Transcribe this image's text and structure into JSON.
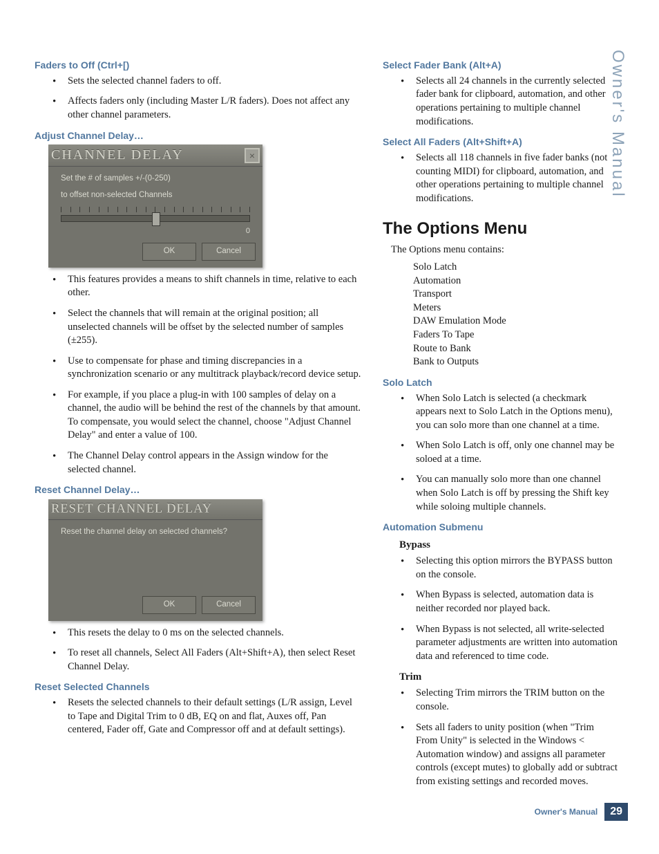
{
  "sideTab": "Owner's Manual",
  "footer": {
    "label": "Owner's Manual",
    "page": "29"
  },
  "left": {
    "sec1": {
      "title": "Faders to Off (Ctrl+[)",
      "b1": "Sets the selected channel faders to off.",
      "b2": "Affects faders only (including Master L/R faders). Does not affect any other channel parameters."
    },
    "sec2": {
      "title": "Adjust Channel Delay…",
      "dlgTitle": "CHANNEL DELAY",
      "dlgLine1": "Set the # of samples +/-(0-250)",
      "dlgLine2": "to offset non-selected Channels",
      "value": "0",
      "ok": "OK",
      "cancel": "Cancel",
      "b1": "This features provides a means to shift channels in time, relative to each other.",
      "b2": "Select the channels that will remain at the original position; all unselected channels will be offset by the selected number of samples (±255).",
      "b3": "Use to compensate for phase and timing discrepancies in a synchronization scenario or any multitrack playback/record device setup.",
      "b4": "For example, if you place a plug-in with 100 samples of delay on a channel, the audio will be behind the rest of the channels by that amount. To compensate, you would select the channel, choose \"Adjust Channel Delay\" and enter a value of 100.",
      "b5": "The Channel Delay control appears in the Assign window for the selected channel."
    },
    "sec3": {
      "title": "Reset Channel Delay…",
      "dlgTitle": "RESET CHANNEL DELAY",
      "dlgLine": "Reset the channel delay on selected channels?",
      "ok": "OK",
      "cancel": "Cancel",
      "b1": "This resets the delay to 0 ms on the selected channels.",
      "b2": "To reset all channels, Select All Faders (Alt+Shift+A), then select Reset Channel Delay."
    },
    "sec4": {
      "title": "Reset Selected Channels",
      "b1": "Resets the selected channels to their default settings (L/R assign, Level to Tape and Digital Trim to 0 dB, EQ on and flat, Auxes off, Pan centered, Fader off, Gate and Compressor off and at default settings)."
    }
  },
  "right": {
    "sec1": {
      "title": "Select Fader Bank (Alt+A)",
      "b1": "Selects all 24 channels in the currently selected fader bank for clipboard, automation, and other operations pertaining to multiple channel modifications."
    },
    "sec2": {
      "title": "Select All Faders (Alt+Shift+A)",
      "b1": "Selects all 118 channels in five fader banks (not counting MIDI) for clipboard, automation, and other operations pertaining to multiple channel modifications."
    },
    "optionsHeading": "The Options Menu",
    "optionsIntro": "The Options menu contains:",
    "menu": {
      "i1": "Solo Latch",
      "i2": "Automation",
      "i3": "Transport",
      "i4": "Meters",
      "i5": "DAW Emulation Mode",
      "i6": "Faders To Tape",
      "i7": "Route to Bank",
      "i8": "Bank to Outputs"
    },
    "solo": {
      "title": "Solo Latch",
      "b1": "When Solo Latch is selected (a checkmark appears next to Solo Latch in the Options menu), you can solo more than one channel at a time.",
      "b2": "When Solo Latch is off, only one channel may be soloed at a time.",
      "b3": "You can manually solo more than one channel when Solo Latch is off by pressing the Shift key while soloing multiple channels."
    },
    "auto": {
      "title": "Automation Submenu",
      "bypassTitle": "Bypass",
      "bypass1": "Selecting this option mirrors the BYPASS button on the console.",
      "bypass2": "When Bypass is selected, automation data is neither recorded nor played back.",
      "bypass3": "When Bypass is not selected, all write-selected parameter adjustments are written into automation data and referenced to time code.",
      "trimTitle": "Trim",
      "trim1": "Selecting Trim mirrors the TRIM button on the console.",
      "trim2": "Sets all faders to unity position (when \"Trim From Unity\" is selected in the Windows < Automation window) and assigns all parameter controls (except mutes) to globally add or subtract from existing settings and recorded moves."
    }
  }
}
